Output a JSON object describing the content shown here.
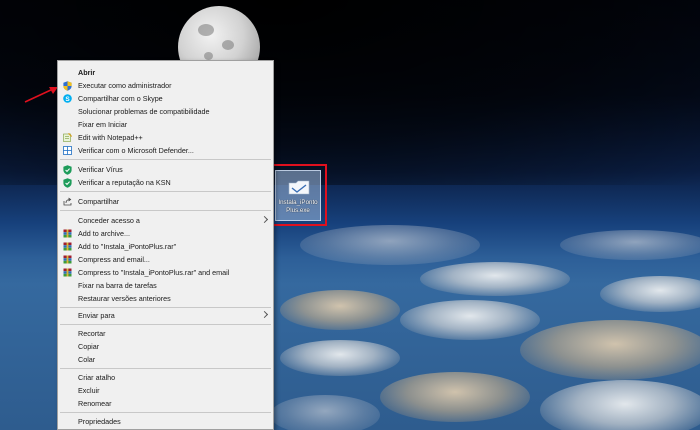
{
  "context_menu": {
    "items": [
      {
        "label": "Abrir",
        "icon": "none",
        "bold": true
      },
      {
        "label": "Executar como administrador",
        "icon": "uac-shield-icon"
      },
      {
        "label": "Compartilhar com o Skype",
        "icon": "skype-icon"
      },
      {
        "label": "Solucionar problemas de compatibilidade",
        "icon": "none"
      },
      {
        "label": "Fixar em Iniciar",
        "icon": "none"
      },
      {
        "label": "Edit with Notepad++",
        "icon": "notepad-plus-plus-icon"
      },
      {
        "label": "Verificar com o Microsoft Defender...",
        "icon": "defender-icon"
      },
      {
        "label": "Verificar Vírus",
        "icon": "kaspersky-shield-icon"
      },
      {
        "label": "Verificar a reputação na KSN",
        "icon": "kaspersky-shield-icon"
      },
      {
        "label": "Compartilhar",
        "icon": "share-icon"
      },
      {
        "label": "Conceder acesso a",
        "icon": "none",
        "submenu": true
      },
      {
        "label": "Add to archive...",
        "icon": "winrar-icon"
      },
      {
        "label": "Add to \"Instala_iPontoPlus.rar\"",
        "icon": "winrar-icon"
      },
      {
        "label": "Compress and email...",
        "icon": "winrar-icon"
      },
      {
        "label": "Compress to \"Instala_iPontoPlus.rar\" and email",
        "icon": "winrar-icon"
      },
      {
        "label": "Fixar na barra de tarefas",
        "icon": "none"
      },
      {
        "label": "Restaurar versões anteriores",
        "icon": "none"
      },
      {
        "label": "Enviar para",
        "icon": "none",
        "submenu": true
      },
      {
        "label": "Recortar",
        "icon": "none"
      },
      {
        "label": "Copiar",
        "icon": "none"
      },
      {
        "label": "Colar",
        "icon": "none"
      },
      {
        "label": "Criar atalho",
        "icon": "none"
      },
      {
        "label": "Excluir",
        "icon": "none"
      },
      {
        "label": "Renomear",
        "icon": "none"
      },
      {
        "label": "Propriedades",
        "icon": "none"
      }
    ]
  },
  "desktop_icon": {
    "label": "Instala_iPontoPlus.exe",
    "icon": "installer-icon"
  },
  "colors": {
    "annotation": "#e0101e",
    "menu_background": "#f0f0f0",
    "uac_shield_blue": "#2f6fd1",
    "uac_shield_yellow": "#f2c01d",
    "skype_blue": "#00aff0",
    "kaspersky_green": "#1e9c5a",
    "winrar_red": "#a01d2f"
  }
}
